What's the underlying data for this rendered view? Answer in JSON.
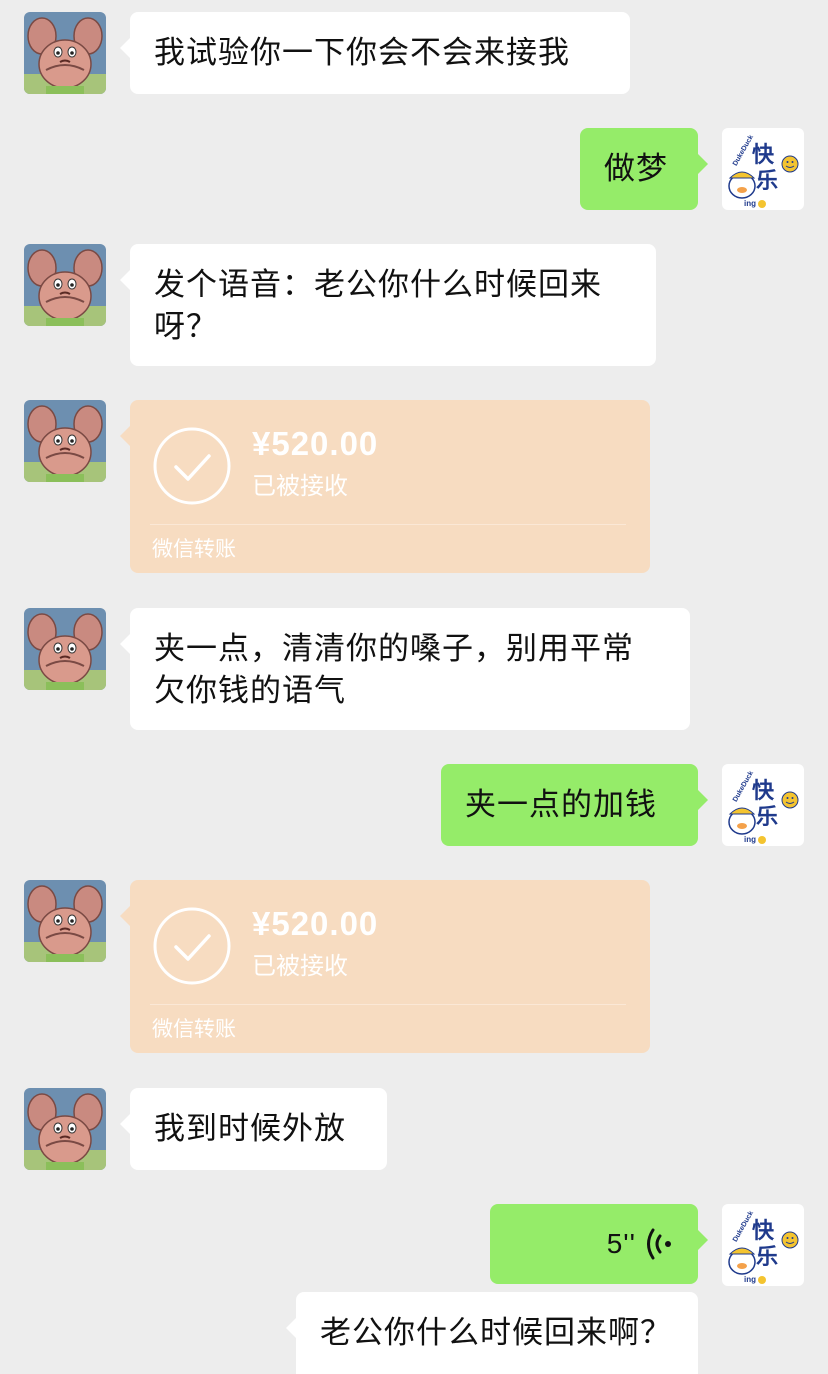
{
  "messages": [
    {
      "side": "left",
      "type": "text",
      "text": "我试验你一下你会不会来接我"
    },
    {
      "side": "right",
      "type": "text",
      "text": "做梦"
    },
    {
      "side": "left",
      "type": "text",
      "line1": "发个语音：老公你什么时候回来",
      "line2": "呀？"
    },
    {
      "side": "left",
      "type": "transfer",
      "amount": "¥520.00",
      "status": "已被接收",
      "footer": "微信转账"
    },
    {
      "side": "left",
      "type": "text",
      "line1": "夹一点，清清你的嗓子，别用平常",
      "line2": "欠你钱的语气"
    },
    {
      "side": "right",
      "type": "text",
      "text": "夹一点的加钱"
    },
    {
      "side": "left",
      "type": "transfer",
      "amount": "¥520.00",
      "status": "已被接收",
      "footer": "微信转账"
    },
    {
      "side": "left",
      "type": "text",
      "text": "我到时候外放"
    },
    {
      "side": "right",
      "type": "voice",
      "duration": "5''",
      "transcript": "老公你什么时候回来啊？"
    }
  ],
  "avatars": {
    "left": {
      "icon": "patrick-star-avatar"
    },
    "right": {
      "icon": "duck-avatar",
      "badge_text": "快乐",
      "small_text": "DukeDuck",
      "ing_text": "ing"
    }
  },
  "colors": {
    "background": "#ededed",
    "incoming_bubble": "#ffffff",
    "outgoing_bubble": "#95ec69",
    "transfer_card": "#f7dcc1"
  }
}
